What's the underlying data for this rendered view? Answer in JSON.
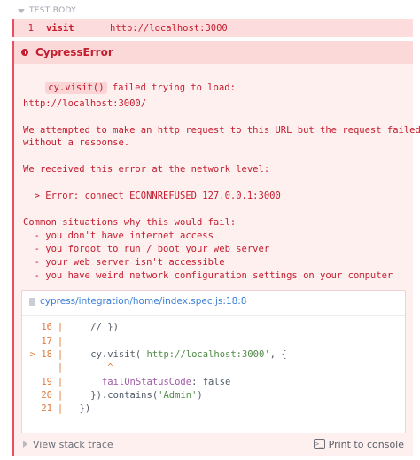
{
  "test_body": {
    "title": "TEST BODY"
  },
  "command": {
    "number": "1",
    "name": "visit",
    "message": "http://localhost:3000"
  },
  "error": {
    "name": "CypressError",
    "code_pill": "cy.visit()",
    "line1_rest": " failed trying to load:",
    "url": "http://localhost:3000/",
    "p1_l1": "We attempted to make an http request to this URL but the request failed",
    "p1_l2": "without a response.",
    "p2": "We received this error at the network level:",
    "p3": "  > Error: connect ECONNREFUSED 127.0.0.1:3000",
    "p4_l1": "Common situations why this would fail:",
    "p4_l2": "  - you don't have internet access",
    "p4_l3": "  - you forgot to run / boot your web server",
    "p4_l4": "  - your web server isn't accessible",
    "p4_l5": "  - you have weird network configuration settings on your computer"
  },
  "code_frame": {
    "file": "cypress/integration/home/index.spec.js:18:8",
    "lines": [
      {
        "num": "16",
        "pipe": "|",
        "code": "    // })"
      },
      {
        "num": "17",
        "pipe": "|",
        "code": ""
      },
      {
        "num": "18",
        "marker": ">",
        "pipe": "|",
        "pre": "    cy.visit(",
        "str": "'http://localhost:3000'",
        "post": ", {"
      },
      {
        "num": "",
        "pipe": "|",
        "caret": "       ^"
      },
      {
        "num": "19",
        "pipe": "|",
        "key": "      failOnStatusCode",
        "post": ": false"
      },
      {
        "num": "20",
        "pipe": "|",
        "pre": "    }).contains(",
        "str": "'Admin'",
        "post": ")"
      },
      {
        "num": "21",
        "pipe": "|",
        "code": "  })"
      }
    ]
  },
  "footer": {
    "stack_label": "View stack trace",
    "print_label": "Print to console",
    "print_icon": ">_"
  },
  "colors": {
    "error_red": "#c41d2e",
    "error_bg": "#fff0f0",
    "border_red": "#e94f5f",
    "link_blue": "#3b7fd5"
  }
}
